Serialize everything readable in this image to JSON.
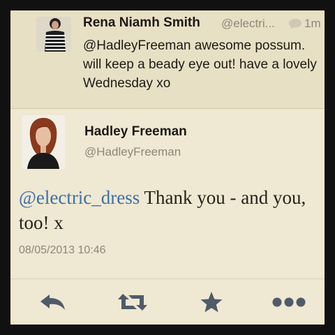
{
  "previous_tweet": {
    "name": "Rena Niamh Smith",
    "handle": "@electri...",
    "time": "1m",
    "text": "@HadleyFreeman awesome possum. will keep a beady eye out! have a lovely Wednesday xo"
  },
  "tweet": {
    "name": "Hadley Freeman",
    "handle": "@HadleyFreeman",
    "mention": "@electric_dress",
    "text": " Thank you - and you, too! x",
    "timestamp": "08/05/2013 10:46"
  },
  "actions": {
    "icons": [
      "reply-icon",
      "retweet-icon",
      "favorite-icon",
      "more-icon"
    ]
  },
  "colors": {
    "background": "#efe8d2",
    "mention": "#3d6fa6",
    "secondary_text": "#8d8778",
    "icon": "#4f5b69"
  }
}
